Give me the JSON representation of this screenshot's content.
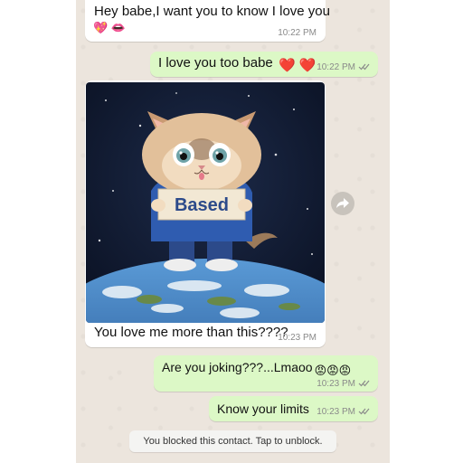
{
  "messages": [
    {
      "text": "Hey babe,I want you to know I love you",
      "emoji": "💖 👄",
      "time": "10:22 PM",
      "direction": "incoming"
    },
    {
      "text": "I love you too babe",
      "emoji": "❤️ ❤️",
      "time": "10:22 PM",
      "direction": "outgoing",
      "status": "read"
    },
    {
      "text": "You love me more than this????",
      "time": "10:23 PM",
      "direction": "incoming",
      "image": {
        "sign_text": "Based"
      }
    },
    {
      "text": "Are you joking???...Lmaoo",
      "emoji": "😡😡😡",
      "time": "10:23 PM",
      "direction": "outgoing",
      "status": "read"
    },
    {
      "text": "Know your limits",
      "time": "10:23 PM",
      "direction": "outgoing",
      "status": "read"
    }
  ],
  "system_message": "You blocked this contact. Tap to unblock.",
  "icons": {
    "forward": "forward-arrow-icon",
    "read": "double-check-icon"
  },
  "colors": {
    "chat_background": "#ece5dd",
    "outgoing": "#dcf8c6",
    "incoming": "#ffffff",
    "tick": "#8a8a8a"
  }
}
